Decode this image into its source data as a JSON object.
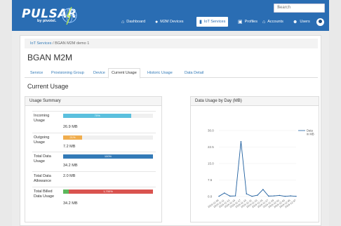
{
  "header": {
    "logo_text": "PULSAR",
    "logo_sub": "by pivotel.",
    "search_placeholder": "Search",
    "nav": [
      {
        "label": "Dashboard",
        "icon": "home-icon"
      },
      {
        "label": "M2M Devices",
        "icon": "globe-icon"
      },
      {
        "label": "IoT Services",
        "icon": "device-icon",
        "active": true
      },
      {
        "label": "Profiles",
        "icon": "briefcase-icon"
      },
      {
        "label": "Accounts",
        "icon": "bank-icon"
      },
      {
        "label": "Users",
        "icon": "users-icon"
      }
    ]
  },
  "breadcrumb": {
    "root": "IoT Services",
    "separator": "/",
    "current": "BGAN M2M demo 1"
  },
  "page_title": "BGAN M2M",
  "tabs": [
    "Service",
    "Provisioning Group",
    "Device",
    "Current Usage",
    "Historic Usage",
    "Data Detail"
  ],
  "active_tab": "Current Usage",
  "section_title": "Current Usage",
  "usage_summary": {
    "title": "Usage Summary",
    "rows": [
      {
        "label": "Incoming Usage",
        "percent_label": "70%",
        "fill": 0.76,
        "color": "#5bc0de",
        "value": "26.9 MB"
      },
      {
        "label": "Outgoing Usage",
        "percent_label": "21%",
        "fill": 0.21,
        "color": "#f0ad4e",
        "value": "7.2 MB"
      },
      {
        "label": "Total Data Usage",
        "percent_label": "100%",
        "fill": 1.0,
        "color": "#337ab7",
        "value": "34.2 MB"
      },
      {
        "label": "Total Data Allowance",
        "percent_label": "",
        "fill": 0,
        "color": "",
        "value": "2.0 MB"
      },
      {
        "label": "Total Billed Data Usage",
        "percent_label": "1,700%",
        "fill": 1.0,
        "color": "#d9534f",
        "green_fill": 0.06,
        "value": "34.2 MB"
      }
    ]
  },
  "chart_panel_title": "Data Usage by Day (MB)",
  "chart_data": {
    "type": "line",
    "x": [
      "2016-11-09",
      "2016-11-11",
      "2016-11-13",
      "2016-11-15",
      "2016-11-17",
      "2016-11-19",
      "2016-11-21",
      "2016-11-23",
      "2016-11-25",
      "2016-11-27",
      "2016-11-29",
      "2016-12-01",
      "2016-12-03",
      "2016-12-05",
      "2016-12-07"
    ],
    "x_tick_labels": [
      "2016-11-09",
      "2016-11-11",
      "2016-11-13",
      "2016-11-15",
      "2016-11-17",
      "2016-11-19",
      "2016-11-21",
      "2016-11-23",
      "2016-11-25",
      "2016-11-27",
      "2016-11-29",
      "2016-12-01",
      "2016-12-03",
      "2016-12-05",
      "2016-12-07"
    ],
    "series": [
      {
        "name": "Data in MB",
        "values": [
          0.1,
          1.6,
          0.2,
          0.3,
          25.0,
          1.2,
          0.1,
          0.6,
          3.2,
          0.2,
          0.3,
          0.5,
          0.1,
          0.3,
          0.1
        ]
      }
    ],
    "yticks": [
      "0.0",
      "7.5",
      "15.0",
      "22.5",
      "30.0"
    ],
    "ylim": [
      0,
      30
    ],
    "legend": "right",
    "color": "#1f5f9f"
  }
}
